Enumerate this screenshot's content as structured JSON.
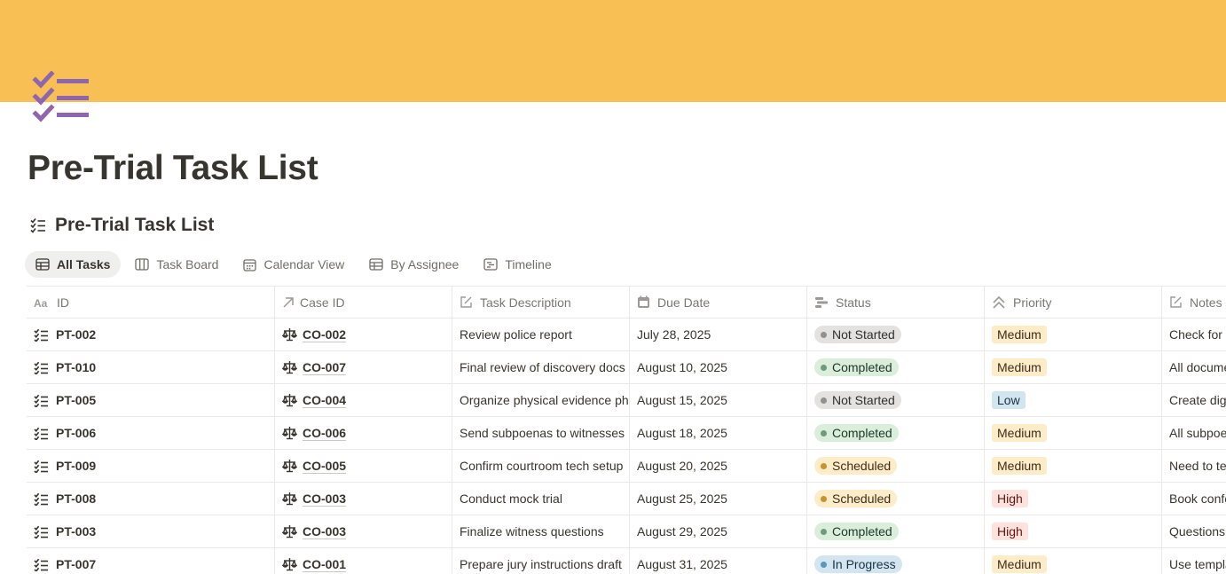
{
  "cover": {
    "color": "#f8bf55"
  },
  "page": {
    "icon": "checklist-icon",
    "icon_color": "#9065b0",
    "title": "Pre-Trial Task List"
  },
  "database": {
    "title": "Pre-Trial Task List",
    "icon": "checklist-icon"
  },
  "views": [
    {
      "label": "All Tasks",
      "icon": "table-icon",
      "active": true
    },
    {
      "label": "Task Board",
      "icon": "board-icon",
      "active": false
    },
    {
      "label": "Calendar View",
      "icon": "calendar-icon",
      "active": false
    },
    {
      "label": "By Assignee",
      "icon": "table-icon",
      "active": false
    },
    {
      "label": "Timeline",
      "icon": "timeline-icon",
      "active": false
    }
  ],
  "columns": [
    {
      "label": "ID",
      "icon": "title-property-icon"
    },
    {
      "label": "Case ID",
      "icon": "relation-arrow-icon"
    },
    {
      "label": "Task Description",
      "icon": "text-edit-icon"
    },
    {
      "label": "Due Date",
      "icon": "calendar-icon"
    },
    {
      "label": "Status",
      "icon": "status-icon"
    },
    {
      "label": "Priority",
      "icon": "select-chevrons-icon"
    },
    {
      "label": "Notes",
      "icon": "text-edit-icon"
    }
  ],
  "status_styles": {
    "Not Started": {
      "bg": "#e3e2e0",
      "dot": "#91918e",
      "text": "#32302c"
    },
    "Completed": {
      "bg": "#dbeddb",
      "dot": "#6c9b7d",
      "text": "#1c3829"
    },
    "Scheduled": {
      "bg": "#fdecc8",
      "dot": "#cb912f",
      "text": "#402c1b"
    },
    "In Progress": {
      "bg": "#d3e5ef",
      "dot": "#5b97bd",
      "text": "#183347"
    }
  },
  "priority_styles": {
    "Medium": {
      "bg": "#fdecc8",
      "text": "#402c1b"
    },
    "Low": {
      "bg": "#d3e5ef",
      "text": "#183347"
    },
    "High": {
      "bg": "#ffe2dd",
      "text": "#5d1715"
    }
  },
  "rows": [
    {
      "id": "PT-002",
      "case": "CO-002",
      "desc": "Review police report",
      "due": "July 28, 2025",
      "status": "Not Started",
      "priority": "Medium",
      "notes": "Check for"
    },
    {
      "id": "PT-010",
      "case": "CO-007",
      "desc": "Final review of discovery docs",
      "due": "August 10, 2025",
      "status": "Completed",
      "priority": "Medium",
      "notes": "All docume"
    },
    {
      "id": "PT-005",
      "case": "CO-004",
      "desc": "Organize physical evidence phc",
      "due": "August 15, 2025",
      "status": "Not Started",
      "priority": "Low",
      "notes": "Create dig"
    },
    {
      "id": "PT-006",
      "case": "CO-006",
      "desc": "Send subpoenas to witnesses",
      "due": "August 18, 2025",
      "status": "Completed",
      "priority": "Medium",
      "notes": "All subpoe"
    },
    {
      "id": "PT-009",
      "case": "CO-005",
      "desc": "Confirm courtroom tech setup",
      "due": "August 20, 2025",
      "status": "Scheduled",
      "priority": "Medium",
      "notes": "Need to te"
    },
    {
      "id": "PT-008",
      "case": "CO-003",
      "desc": "Conduct mock trial",
      "due": "August 25, 2025",
      "status": "Scheduled",
      "priority": "High",
      "notes": "Book confe"
    },
    {
      "id": "PT-003",
      "case": "CO-003",
      "desc": "Finalize witness questions",
      "due": "August 29, 2025",
      "status": "Completed",
      "priority": "High",
      "notes": "Questions"
    },
    {
      "id": "PT-007",
      "case": "CO-001",
      "desc": "Prepare jury instructions draft",
      "due": "August 31, 2025",
      "status": "In Progress",
      "priority": "Medium",
      "notes": "Use templa"
    }
  ]
}
